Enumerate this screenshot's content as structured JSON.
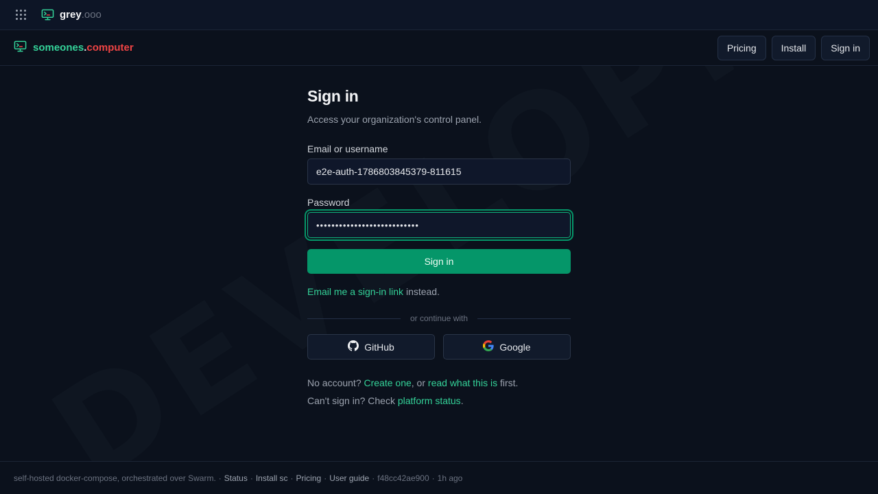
{
  "watermark": "DEVELOPMENT",
  "topbar": {
    "brand_main": "grey",
    "brand_suffix": ".ooo"
  },
  "site": {
    "name_part1": "someones",
    "name_dot": ".",
    "name_part2": "computer"
  },
  "nav": {
    "pricing": "Pricing",
    "install": "Install",
    "signin": "Sign in"
  },
  "form": {
    "title": "Sign in",
    "subtitle": "Access your organization's control panel.",
    "email_label": "Email or username",
    "email_value": "e2e-auth-1786803845379-811615",
    "password_label": "Password",
    "password_value": "•••••••••••••••••••••••••••",
    "submit": "Sign in",
    "magic_link": "Email me a sign-in link",
    "magic_suffix": " instead.",
    "divider": "or continue with",
    "github": "GitHub",
    "google": "Google",
    "no_account_prefix": "No account? ",
    "create_one": "Create one",
    "or_text": ", or ",
    "read_what": "read what this is",
    "first_text": " first.",
    "cant_signin_prefix": "Can't sign in? Check ",
    "platform_status": "platform status",
    "period": "."
  },
  "footer": {
    "text": "self-hosted docker-compose, orchestrated over Swarm.",
    "status": "Status",
    "install": "Install sc",
    "pricing": "Pricing",
    "guide": "User guide",
    "commit": "f48cc42ae900",
    "age": "1h ago",
    "sep": "·"
  },
  "colors": {
    "accent": "#10b981",
    "accent_dark": "#059669",
    "brand_red": "#ef4444",
    "background": "#0b111c"
  },
  "icons": [
    "apps-grid-icon",
    "terminal-monitor-icon",
    "github-icon",
    "google-icon"
  ]
}
